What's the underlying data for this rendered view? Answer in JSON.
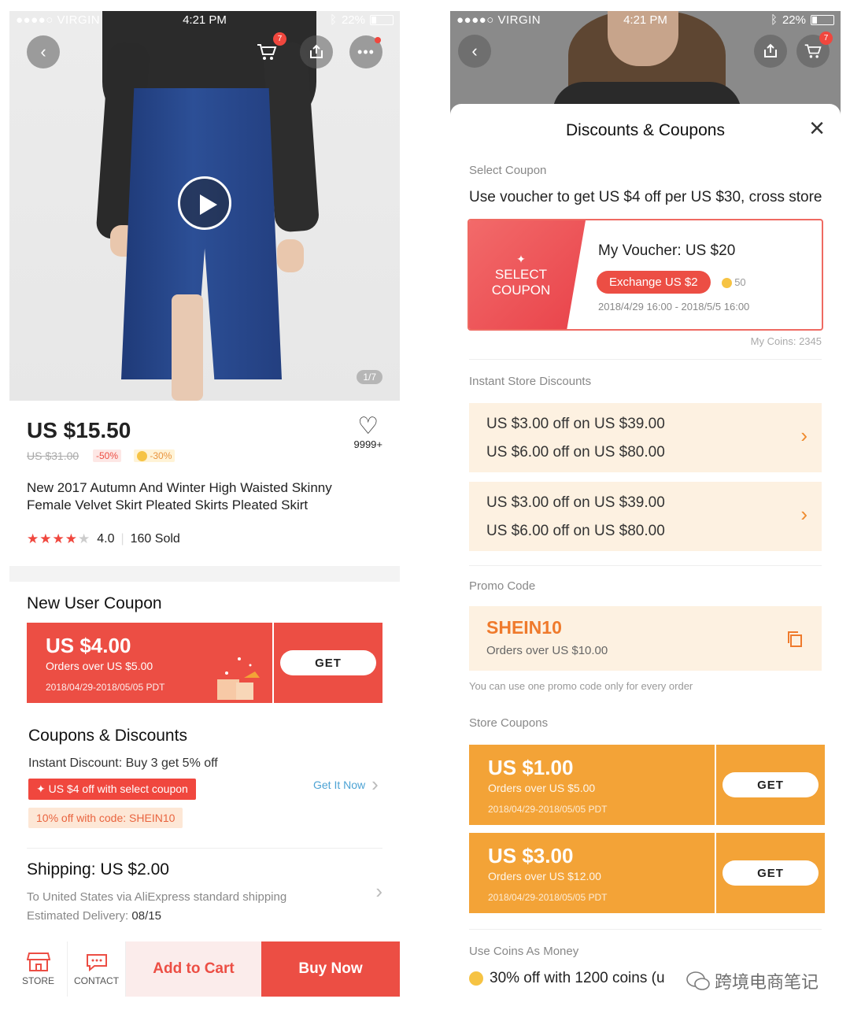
{
  "left": {
    "status": {
      "carrier": "●●●●○ VIRGIN",
      "time": "4:21 PM",
      "battery": "22%"
    },
    "header": {
      "cart_badge": "7",
      "pager": "1/7"
    },
    "product": {
      "price": "US $15.50",
      "old_price": "US $31.00",
      "discount": "-50%",
      "coin_discount": "-30%",
      "wishlist_count": "9999+",
      "title": "New 2017 Autumn And Winter High Waisted Skinny Female Velvet Skirt Pleated Skirts Pleated Skirt",
      "rating_stars": 4,
      "rating": "4.0",
      "sold": "160 Sold"
    },
    "new_user_coupon": {
      "heading": "New User Coupon",
      "amount": "US $4.00",
      "condition": "Orders over US $5.00",
      "validity": "2018/04/29-2018/05/05 PDT",
      "button": "GET"
    },
    "coupons_discounts": {
      "heading": "Coupons & Discounts",
      "instant": "Instant Discount: Buy 3 get 5% off",
      "select_coupon_tag": "✦ US $4 off with select coupon",
      "code_tag": "10% off with code: SHEIN10",
      "link": "Get It Now"
    },
    "shipping": {
      "heading": "Shipping: US $2.00",
      "line1": "To United States via AliExpress standard shipping",
      "delivery_label": "Estimated Delivery:",
      "delivery_date": "08/15"
    },
    "bottom": {
      "store": "STORE",
      "contact": "CONTACT",
      "add_to_cart": "Add to Cart",
      "buy_now": "Buy Now"
    }
  },
  "right": {
    "status": {
      "carrier": "●●●●○ VIRGIN",
      "time": "4:21 PM",
      "battery": "22%"
    },
    "header": {
      "cart_badge": "7"
    },
    "sheet": {
      "title": "Discounts & Coupons",
      "select_coupon_label": "Select Coupon",
      "voucher_text": "Use voucher to get US $4 off per US $30, cross store",
      "voucher": {
        "left_label": "SELECT COUPON",
        "left_symbol": "✦",
        "my_voucher": "My Voucher: US $20",
        "exchange": "Exchange US $2",
        "coins_cost": "50",
        "validity": "2018/4/29 16:00 - 2018/5/5 16:00"
      },
      "my_coins": "My Coins: 2345",
      "instant_label": "Instant Store Discounts",
      "instant": [
        {
          "l1": "US $3.00 off on US $39.00",
          "l2": "US $6.00 off on US $80.00"
        },
        {
          "l1": "US $3.00 off on US $39.00",
          "l2": "US $6.00 off on US $80.00"
        }
      ],
      "promo_label": "Promo Code",
      "promo_code": "SHEIN10",
      "promo_condition": "Orders over US $10.00",
      "promo_note": "You can use one promo code only for every order",
      "store_coupons_label": "Store Coupons",
      "store_coupons": [
        {
          "amount": "US $1.00",
          "condition": "Orders over US $5.00",
          "validity": "2018/04/29-2018/05/05 PDT",
          "button": "GET"
        },
        {
          "amount": "US $3.00",
          "condition": "Orders over US $12.00",
          "validity": "2018/04/29-2018/05/05 PDT",
          "button": "GET"
        }
      ],
      "coins_label": "Use Coins As Money",
      "coins_text": "30% off with 1200 coins (u",
      "watermark": "跨境电商笔记"
    }
  },
  "colors": {
    "red": "#ec4e44",
    "orange": "#f3a337",
    "peach": "#fdf1e1",
    "text": "#222222",
    "muted": "#888888"
  }
}
